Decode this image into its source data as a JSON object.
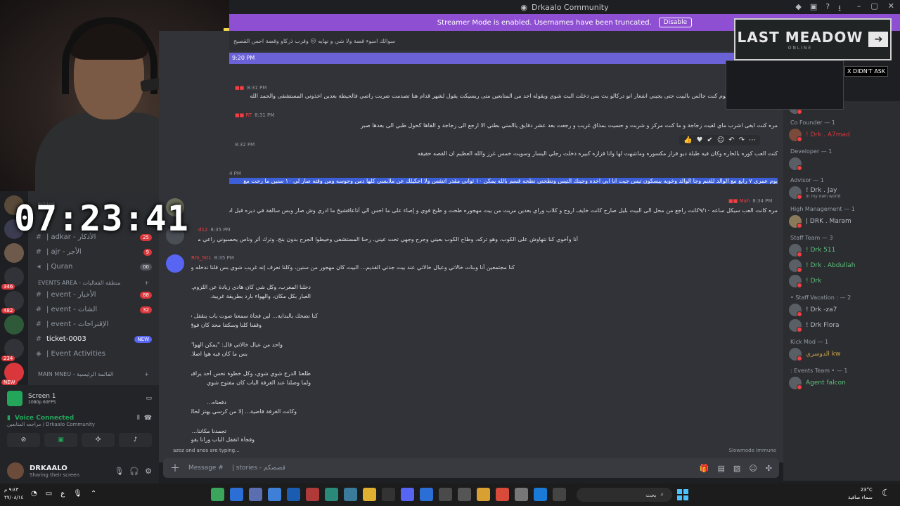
{
  "window": {
    "title": "Drkaalo Community"
  },
  "banner": {
    "text": "Streamer Mode is enabled. Usernames have been truncated.",
    "button": "Disable"
  },
  "timer": "07:23:41",
  "overlay": {
    "title": "LAST MEADOW",
    "subtitle": "ONLINE",
    "x_didnt_ask": "X DIDN'T ASK"
  },
  "chat": {
    "highlight_time": "9:20 PM",
    "messages": [
      {
        "time": "8:31 PM",
        "text": "اح اموت بدأت القصة يوم كنت جالس بالبيت حتى يجيني اشعار انو دركالو بث بس دخلت البث شوي ويقوله احد من المتابعين متى ريسيكت يقول لشهر قدام هنا تصدمت ضربت راصي فالحيطة بعدين اخذوني المستشفى والحمد الله"
      },
      {
        "time": "8:31 PM",
        "text": "مره كنت ابغى اشرب ماي لقيت زجاجة و ما كنت مركز و شربت و حسيت بمذاق غريب و رجعت بعد عشر دقايق ياالمني بطني الا ارجع الى زجاجة و القاها كحول طبي الى بعدها صبر"
      },
      {
        "time": "8:32 PM",
        "text": "كنت العب كوره بالحاره وكان فيه طبلة ديو قزاز مكسوره ومانتبهت لها وانا قزازه كبيره دخلت رجلي اليسار وسويت خمس غرز والله العظيم ان القصه حقيقه"
      },
      {
        "time": "",
        "text": "يوم عمري ٧ رابع مع الوالد للغنم وجا الوالد وخويه بيسكون تيس جيت انا ابي اخده وجيتك التيس ونطحني نطحه قسم بالله يمكن ١٠ ثواني مقدر اتنفس ولا احكيلك عن ملابسي كلها دمن وحوسه ومن وقته صار لي ١٠ سنين ما رحت مع"
      },
      {
        "time": "8:34 PM",
        "text": "مره كانت العب سيكل ساعه ٩/١٠كانت راجع من محل الى البيت بليل صارح كانت خايف اروح و كلاب وراي بعدين مريت من بيت مهجوره طحت و طيح فوي و إصاء على ما احس الي أناعاقشيخ ما ادري وش صار وبس سالفة في ديره قبل اسنوات"
      },
      {
        "time": "8:35 PM",
        "text": "أنا وأخوي كنا نتهاوش على الكوب، وهو تركه، وطاح الكوب بعيني وجرح وجهي تحت عيني. رحنا المستشفى وخيطوا الجرح بدون بنج. وترك أثر وناس يحسبوني راعي مشاكل"
      },
      {
        "time": "8:35 PM",
        "text": "كنا مجتمعين أنا وبنات خالاتي وعيال خالاتي عند بيت جدتي القديم... البيت كان مهجور من سنين، وكلنا نعرف إنه غريب شوي بس قلنا ندخله ونشوف."
      }
    ],
    "story_lines": [
      "دخلنا المغرب، وكل شي كان هادي زيادة عن اللزوم...",
      "الغبار بكل مكان، والهواء بارد بطريقة غريبة.",
      "كنا نضحك بالبداية... لين فجأة سمعنا صوت باب ينقفل فوق",
      "وقفنا كلنا وسكتنا محد كان فوق.",
      "واحد من عيال خالاتي قال: \"يمكن الهوا\"",
      "بس ما كان فيه هوا اصلا.",
      "طلعنا الدرج شوي شوي، وكل خطوة نحس أحد يراقبنا",
      "ولما وصلنا عند الغرفة الباب كان مفتوح شوي",
      "دفعناه...",
      "وكانت الغرفة فاضية... إلا من كرسي يهتز لحاله",
      "تجمدنا مكاننا...",
      "وفجأة انقفل الباب ورانا بقوة!!"
    ],
    "typing": "azoz and anos are typing...",
    "slowmode": "Slowmode Immune",
    "composer_placeholder": "Message #",
    "composer_channel": "| stories - قصصكم"
  },
  "sidebar": {
    "top_label": "rships",
    "channels": [
      {
        "label": "| adkar - الأذكار",
        "badge": "25"
      },
      {
        "label": "| ajr - الأجر",
        "badge": "9"
      },
      {
        "label": "| Quran",
        "badge": "00"
      },
      {
        "label": "| event - الأخبار",
        "badge": "88"
      },
      {
        "label": "| event - الشات",
        "badge": "32"
      },
      {
        "label": "| event - الإقتراحات",
        "badge": ""
      },
      {
        "label": "ticket-0003",
        "badge": "NEW"
      },
      {
        "label": "| Event Activities",
        "badge": ""
      }
    ],
    "category_events": "EVENTS AREA - منطقة الفعاليات",
    "category_main": "MAIN MNEU - القائمة الرئيسية"
  },
  "servers": {
    "badges": [
      "346",
      "482",
      "234",
      "NEW"
    ]
  },
  "bottom": {
    "screen_title": "Screen 1",
    "screen_sub": "1080p 60FPS",
    "voice_title": "Voice Connected",
    "voice_sub": "مراجعه المتابعين / Drkaalo Community",
    "user_name": "DRKAALO",
    "user_status": "Sharing their screen"
  },
  "members": {
    "roles": [
      {
        "name": "Co Founder — 1",
        "members": [
          {
            "name": "! Drk . A7mad",
            "sub": ""
          }
        ]
      },
      {
        "name": "Developer — 1",
        "members": [
          {
            "name": "",
            "sub": ""
          }
        ]
      },
      {
        "name": "Advisor — 1",
        "members": [
          {
            "name": "! Drk . Jay",
            "sub": "in my own world"
          }
        ]
      },
      {
        "name": "High Management — 1",
        "members": [
          {
            "name": "| DRK . Maram",
            "sub": ""
          }
        ]
      },
      {
        "name": "Staff Team — 3",
        "members": [
          {
            "name": "! Drk 511",
            "sub": ""
          },
          {
            "name": "! Drk . Abdullah",
            "sub": ""
          },
          {
            "name": "! Drk",
            "sub": ""
          }
        ]
      },
      {
        "name": "• Staff Vacation : — 2",
        "members": [
          {
            "name": "! Drk -za7",
            "sub": ""
          },
          {
            "name": "! Drk Flora",
            "sub": ""
          }
        ]
      },
      {
        "name": "Kick Mod — 1",
        "members": [
          {
            "name": "الدوسري kw",
            "sub": ""
          }
        ]
      },
      {
        "name": ": Events Team • — 1",
        "members": [
          {
            "name": "Agent falcon",
            "sub": ""
          }
        ]
      }
    ]
  },
  "taskbar": {
    "time": "٩:٤٣ م",
    "date": "٢٧/٠٨/١٤",
    "lang": "ع",
    "search": "بحث",
    "temp": "23°C",
    "weather": "سماء صافية"
  }
}
